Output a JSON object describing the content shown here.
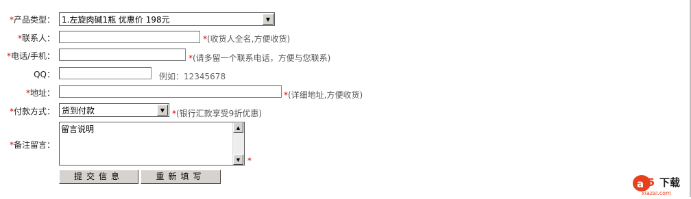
{
  "form": {
    "product": {
      "required": "*",
      "label": "产品类型：",
      "selected": "1.左旋肉碱1瓶 优惠价 198元"
    },
    "contact": {
      "required": "*",
      "label": "联系人：",
      "value": "",
      "hint_req": "*",
      "hint": "(收货人全名,方便收货)"
    },
    "phone": {
      "required": "*",
      "label": "电话/手机：",
      "value": "",
      "hint_req": "*",
      "hint": "(请多留一个联系电话，方便与您联系)"
    },
    "qq": {
      "label": "QQ：",
      "value": "",
      "hint": "例如：12345678"
    },
    "address": {
      "required": "*",
      "label": "地址：",
      "value": "",
      "hint_req": "*",
      "hint": "(详细地址,方便收货)"
    },
    "payment": {
      "required": "*",
      "label": "付款方式：",
      "selected": "货到付款",
      "hint_req": "*",
      "hint": "(银行汇款享受9折优惠)"
    },
    "message": {
      "required": "*",
      "label": "备注留言：",
      "value": "留言说明",
      "after_req": "*"
    }
  },
  "buttons": {
    "submit": "提交信息",
    "reset": "重新填写"
  },
  "watermark": {
    "brand": "a5",
    "text": "下载",
    "domain": "xiazai.com"
  },
  "colors": {
    "required": "#d40000",
    "button_face": "#d6d3ce",
    "logo_red": "#e8401c"
  }
}
